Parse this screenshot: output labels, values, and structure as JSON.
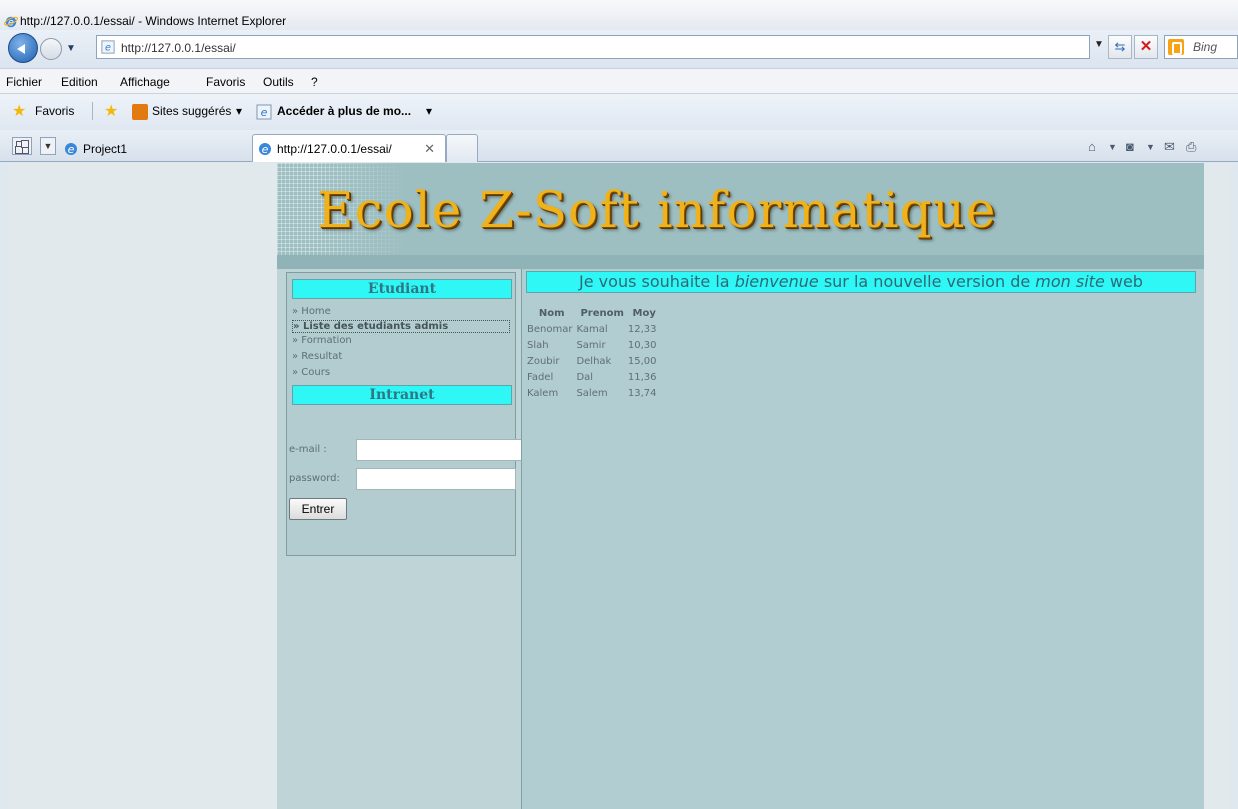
{
  "window": {
    "title": "http://127.0.0.1/essai/ - Windows Internet Explorer"
  },
  "addressbar": {
    "url": "http://127.0.0.1/essai/",
    "search_placeholder": "Bing"
  },
  "menubar": {
    "items": [
      "Fichier",
      "Edition",
      "Affichage",
      "Favoris",
      "Outils",
      "?"
    ]
  },
  "favorites_bar": {
    "favorites_label": "Favoris",
    "suggested_sites_label": "Sites suggérés",
    "more_addons_label": "Accéder à plus de mo..."
  },
  "tabs": [
    {
      "label": "Project1",
      "active": false
    },
    {
      "label": "http://127.0.0.1/essai/",
      "active": true
    }
  ],
  "site": {
    "banner_title": "Ecole Z-Soft informatique",
    "sidebar": {
      "etudiant_header": "Etudiant",
      "links": [
        {
          "label": "» Home",
          "selected": false
        },
        {
          "label": "» Liste des etudiants admis",
          "selected": true
        },
        {
          "label": "» Formation",
          "selected": false
        },
        {
          "label": "» Resultat",
          "selected": false
        },
        {
          "label": "» Cours",
          "selected": false
        }
      ],
      "intranet_header": "Intranet",
      "email_label": "e-mail :",
      "password_label": "password:",
      "submit_label": "Entrer"
    },
    "welcome": {
      "part1": "Je vous souhaite la ",
      "em1": "bienvenue",
      "part2": " sur la nouvelle version de ",
      "em2": "mon site",
      "part3": " web"
    },
    "table": {
      "headers": [
        "Nom",
        "Prenom",
        "Moy"
      ],
      "rows": [
        [
          "Benomar",
          "Kamal",
          "12,33"
        ],
        [
          "Slah",
          "Samir",
          "10,30"
        ],
        [
          "Zoubir",
          "Delhak",
          "15,00"
        ],
        [
          "Fadel",
          "Dal",
          "11,36"
        ],
        [
          "Kalem",
          "Salem",
          "13,74"
        ]
      ]
    }
  }
}
